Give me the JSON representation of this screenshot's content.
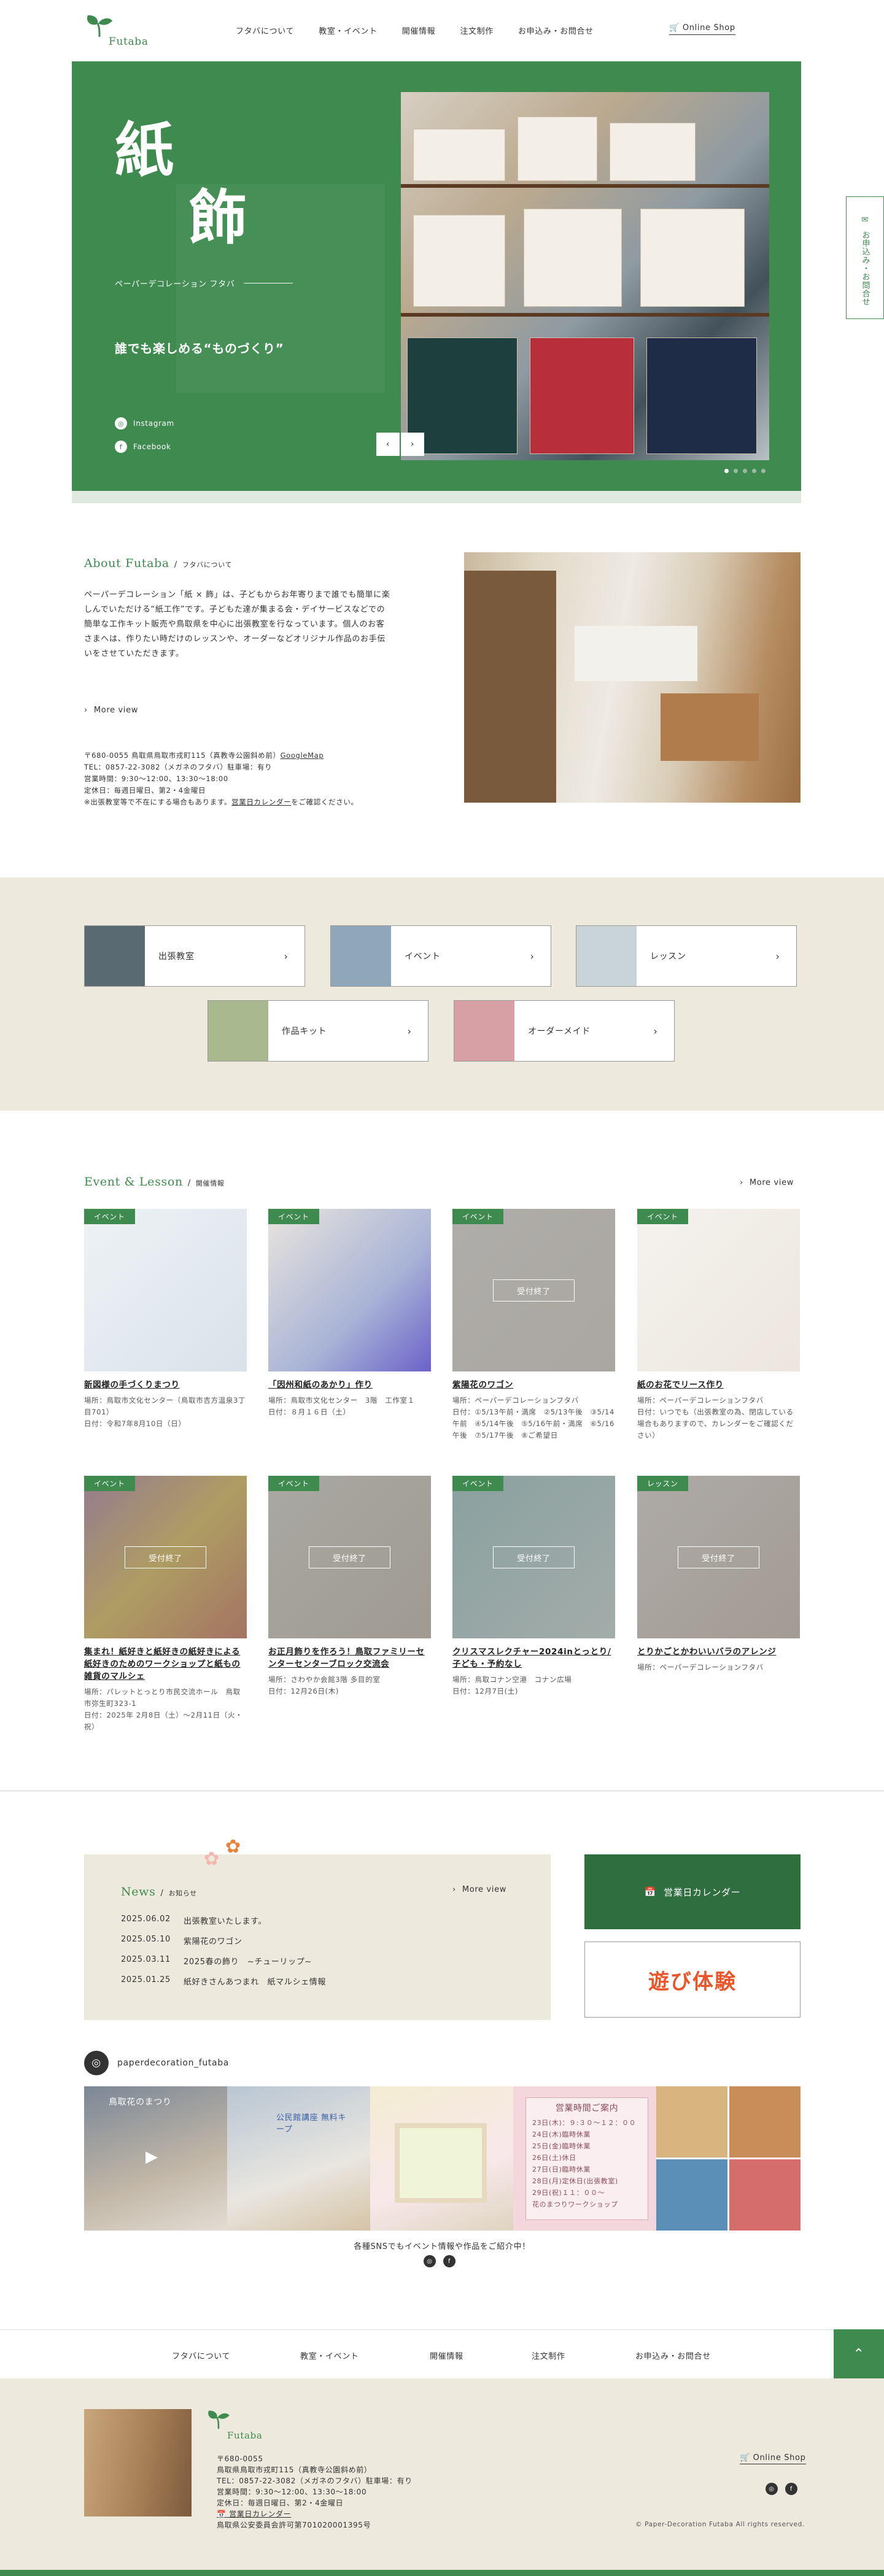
{
  "brand": {
    "name": "Futaba",
    "accent": "#3f8b4f",
    "beige": "#eee9dd"
  },
  "nav": [
    "フタバについて",
    "教室・イベント",
    "開催情報",
    "注文制作",
    "お申込み・お問合せ"
  ],
  "online_shop": "Online Shop",
  "side_tab": "お申込み・お問合せ",
  "hero": {
    "title_1": "紙",
    "title_2": "飾",
    "subtitle": "ペーパーデコレーション フタバ",
    "catch": "誰でも楽しめる“ものづくり”",
    "instagram": "Instagram",
    "facebook": "Facebook",
    "prev": "‹",
    "next": "›",
    "slides": 5,
    "active_slide": 1
  },
  "about": {
    "title_en": "About Futaba",
    "title_jp": "フタバについて",
    "body": "ペーパーデコレーション「紙 × 飾」は、子どもからお年寄りまで誰でも簡単に楽しんでいただける“紙工作”です。子どもた達が集まる会・デイサービスなどでの簡単な工作キット販売や鳥取県を中心に出張教室を行なっています。個人のお客さまへは、作りたい時だけのレッスンや、オーダーなどオリジナル作品のお手伝いをさせていただきます。",
    "more": "More view",
    "address": "〒680-0055 鳥取県鳥取市戎町115（真教寺公園斜め前）",
    "map_link": "GoogleMap",
    "tel": "TEL：0857-22-3082（メガネのフタバ）駐車場：有り",
    "hours": "営業時間：9:30～12:00、13:30～18:00",
    "holiday": "定休日：毎週日曜日、第2・4金曜日",
    "note_pre": "※出張教室等で不在にする場合もあります。",
    "note_link": "営業日カレンダー",
    "note_post": "をご確認ください。"
  },
  "categories": [
    "出張教室",
    "イベント",
    "レッスン",
    "作品キット",
    "オーダーメイド"
  ],
  "events": {
    "title_en": "Event & Lesson",
    "title_jp": "開催情報",
    "more": "More view",
    "done_label": "受付終了",
    "items": [
      {
        "tag": "イベント",
        "name": "新図様の手づくりまつり",
        "meta": [
          "場所：鳥取市文化センター（鳥取市吉方温泉3丁目701）",
          "日付：令和7年8月10日（日）"
        ],
        "closed": false
      },
      {
        "tag": "イベント",
        "name": "「因州和紙のあかり」作り",
        "meta": [
          "場所：鳥取市文化センター　3階　工作室１",
          "日付：８月１６日（土）"
        ],
        "closed": false
      },
      {
        "tag": "イベント",
        "name": "紫陽花のワゴン",
        "meta": [
          "場所：ペーパーデコレーションフタバ",
          "日付：①5/13午前・満席　②5/13午後　③5/14午前　④5/14午後　⑤5/16午前・満席　⑥5/16午後　⑦5/17午後　⑧ご希望日"
        ],
        "closed": true
      },
      {
        "tag": "イベント",
        "name": "紙のお花でリース作り",
        "meta": [
          "場所：ペーパーデコレーションフタバ",
          "日付：いつでも（出張教室の為、閉店している場合もありますので、カレンダーをご確認ください）"
        ],
        "closed": false
      },
      {
        "tag": "イベント",
        "name": "集まれ！紙好きと紙好きの紙好きによる紙好きのためのワークショップと紙もの雑貨のマルシェ",
        "meta": [
          "場所：パレットとっとり市民交流ホール　鳥取市弥生町323-1",
          "日付：2025年 2月8日（土）～2月11日（火・祝）"
        ],
        "closed": true
      },
      {
        "tag": "イベント",
        "name": "お正月飾りを作ろう！鳥取ファミリーセンターセンターブロック交流会",
        "meta": [
          "場所：さわやか会館3階 多目的室",
          "日付：12月26日(木)"
        ],
        "closed": true
      },
      {
        "tag": "イベント",
        "name": "クリスマスレクチャー2024inとっとり/子ども・予約なし",
        "meta": [
          "場所：鳥取コナン空港　コナン広場",
          "日付：12月7日(土)"
        ],
        "closed": true
      },
      {
        "tag": "レッスン",
        "name": "とりかごとかわいいバラのアレンジ",
        "meta": [
          "場所：ペーパーデコレーションフタバ"
        ],
        "closed": true
      }
    ]
  },
  "news": {
    "title_en": "News",
    "title_jp": "お知らせ",
    "more": "More view",
    "items": [
      {
        "date": "2025.06.02",
        "title": "出張教室いたします。"
      },
      {
        "date": "2025.05.10",
        "title": "紫陽花のワゴン"
      },
      {
        "date": "2025.03.11",
        "title": "2025春の飾り　~チューリップ~"
      },
      {
        "date": "2025.01.25",
        "title": "紙好きさんあつまれ　紙マルシェ情報"
      }
    ]
  },
  "calendar_button": "営業日カレンダー",
  "asobi_logo": "遊び体験",
  "instagram": {
    "account": "paperdecoration_futaba",
    "post1_caption": "鳥取花のまつり",
    "post2_caption": "公民館講座 無料キープ",
    "post3_title": "営業時間ご案内",
    "post3_lines": [
      "23日(木)：９:３０～１２：００",
      "24日(木)臨時休業",
      "25日(金)臨時休業",
      "26日(土)休日",
      "27日(日)臨時休業",
      "28日(月)定休日(出張教室)",
      "29日(祝)１１：００～",
      "花のまつりワークショップ"
    ],
    "note": "各種SNSでもイベント情報や作品をご紹介中！"
  },
  "footer_nav": [
    "フタバについて",
    "教室・イベント",
    "開催情報",
    "注文制作",
    "お申込み・お問合せ"
  ],
  "footer": {
    "zip": "〒680-0055",
    "address": "鳥取県鳥取市戎町115（真教寺公園斜め前）",
    "tel": "TEL：0857-22-3082（メガネのフタバ）駐車場：有り",
    "hours": "営業時間：9:30～12:00、13:30～18:00",
    "holiday": "定休日：毎週日曜日、第2・4金曜日",
    "calendar_link": "営業日カレンダー",
    "license": "鳥取県公安委員会許可第701020001395号",
    "shop": "Online Shop",
    "copyright": "© Paper-Decoration Futaba All rights reserved."
  }
}
